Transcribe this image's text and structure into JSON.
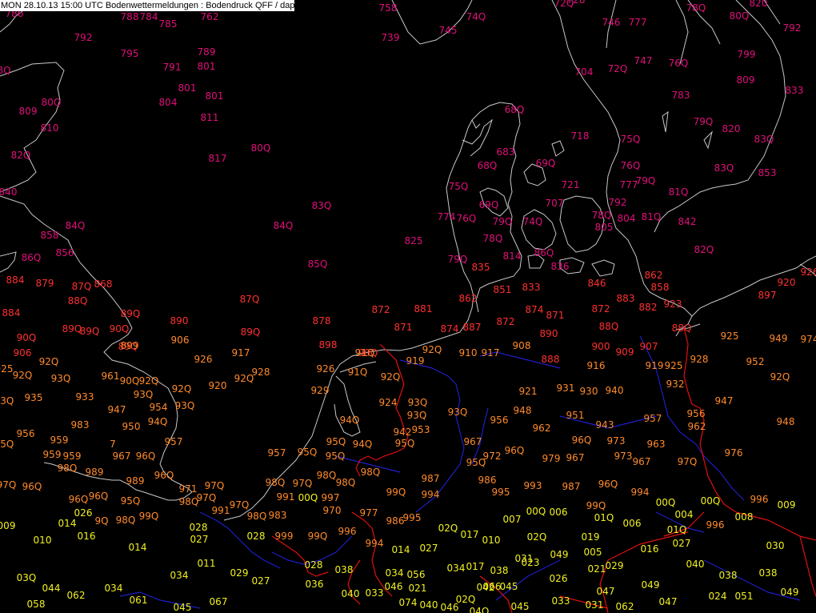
{
  "title": "MON 28.10.13 15:00 UTC  Bodenwettermeldungen :  Bodendruck QFF / dapa",
  "colors": {
    "background": "#000000",
    "coast": "#c8c8c8",
    "river": "#1e1ec8",
    "border": "#e01010",
    "magenta": "#e0107a",
    "red": "#ff3030",
    "orange": "#ff8a2a",
    "yellow": "#f0f020"
  },
  "observations": [
    {
      "t": "786",
      "c": "magenta"
    },
    {
      "t": "792",
      "c": "magenta"
    },
    {
      "t": "788",
      "c": "magenta"
    },
    {
      "t": "784",
      "c": "magenta"
    },
    {
      "t": "785",
      "c": "magenta"
    },
    {
      "t": "762",
      "c": "magenta"
    },
    {
      "t": "758",
      "c": "magenta"
    },
    {
      "t": "739",
      "c": "magenta"
    },
    {
      "t": "74Q",
      "c": "magenta"
    },
    {
      "t": "745",
      "c": "magenta"
    },
    {
      "t": "728",
      "c": "magenta"
    },
    {
      "t": "72Q",
      "c": "magenta"
    },
    {
      "t": "746",
      "c": "magenta"
    },
    {
      "t": "777",
      "c": "magenta"
    },
    {
      "t": "78Q",
      "c": "magenta"
    },
    {
      "t": "80Q",
      "c": "magenta"
    },
    {
      "t": "820",
      "c": "magenta"
    },
    {
      "t": "792",
      "c": "magenta"
    },
    {
      "t": "795",
      "c": "magenta"
    },
    {
      "t": "789",
      "c": "magenta"
    },
    {
      "t": "791",
      "c": "magenta"
    },
    {
      "t": "801",
      "c": "magenta"
    },
    {
      "t": "801",
      "c": "magenta"
    },
    {
      "t": "804",
      "c": "magenta"
    },
    {
      "t": "801",
      "c": "magenta"
    },
    {
      "t": "811",
      "c": "magenta"
    },
    {
      "t": "704",
      "c": "magenta"
    },
    {
      "t": "72Q",
      "c": "magenta"
    },
    {
      "t": "747",
      "c": "magenta"
    },
    {
      "t": "76Q",
      "c": "magenta"
    },
    {
      "t": "799",
      "c": "magenta"
    },
    {
      "t": "809",
      "c": "magenta"
    },
    {
      "t": "833",
      "c": "magenta"
    },
    {
      "t": "783",
      "c": "magenta"
    },
    {
      "t": "8Q",
      "c": "magenta"
    },
    {
      "t": "809",
      "c": "magenta"
    },
    {
      "t": "80Q",
      "c": "magenta"
    },
    {
      "t": "810",
      "c": "magenta"
    },
    {
      "t": "68Q",
      "c": "magenta"
    },
    {
      "t": "718",
      "c": "magenta"
    },
    {
      "t": "75Q",
      "c": "magenta"
    },
    {
      "t": "79Q",
      "c": "magenta"
    },
    {
      "t": "820",
      "c": "magenta"
    },
    {
      "t": "83Q",
      "c": "magenta"
    },
    {
      "t": "683",
      "c": "magenta"
    },
    {
      "t": "68Q",
      "c": "magenta"
    },
    {
      "t": "69Q",
      "c": "magenta"
    },
    {
      "t": "76Q",
      "c": "magenta"
    },
    {
      "t": "83Q",
      "c": "magenta"
    },
    {
      "t": "853",
      "c": "magenta"
    },
    {
      "t": "82Q",
      "c": "magenta"
    },
    {
      "t": "817",
      "c": "magenta"
    },
    {
      "t": "80Q",
      "c": "magenta"
    },
    {
      "t": "75Q",
      "c": "magenta"
    },
    {
      "t": "721",
      "c": "magenta"
    },
    {
      "t": "777",
      "c": "magenta"
    },
    {
      "t": "79Q",
      "c": "magenta"
    },
    {
      "t": "81Q",
      "c": "magenta"
    },
    {
      "t": "840",
      "c": "magenta"
    },
    {
      "t": "83Q",
      "c": "magenta"
    },
    {
      "t": "69Q",
      "c": "magenta"
    },
    {
      "t": "707",
      "c": "magenta"
    },
    {
      "t": "792",
      "c": "magenta"
    },
    {
      "t": "774",
      "c": "magenta"
    },
    {
      "t": "76Q",
      "c": "magenta"
    },
    {
      "t": "79Q",
      "c": "magenta"
    },
    {
      "t": "74Q",
      "c": "magenta"
    },
    {
      "t": "78Q",
      "c": "magenta"
    },
    {
      "t": "804",
      "c": "magenta"
    },
    {
      "t": "81Q",
      "c": "magenta"
    },
    {
      "t": "842",
      "c": "magenta"
    },
    {
      "t": "84Q",
      "c": "magenta"
    },
    {
      "t": "84Q",
      "c": "magenta"
    },
    {
      "t": "805",
      "c": "magenta"
    },
    {
      "t": "858",
      "c": "magenta"
    },
    {
      "t": "78Q",
      "c": "magenta"
    },
    {
      "t": "825",
      "c": "magenta"
    },
    {
      "t": "856",
      "c": "magenta"
    },
    {
      "t": "86Q",
      "c": "magenta"
    },
    {
      "t": "82Q",
      "c": "magenta"
    },
    {
      "t": "79Q",
      "c": "magenta"
    },
    {
      "t": "814",
      "c": "magenta"
    },
    {
      "t": "86Q",
      "c": "magenta"
    },
    {
      "t": "85Q",
      "c": "magenta"
    },
    {
      "t": "835",
      "c": "red"
    },
    {
      "t": "836",
      "c": "magenta"
    },
    {
      "t": "862",
      "c": "red"
    },
    {
      "t": "884",
      "c": "red"
    },
    {
      "t": "879",
      "c": "red"
    },
    {
      "t": "87Q",
      "c": "red"
    },
    {
      "t": "868",
      "c": "red"
    },
    {
      "t": "851",
      "c": "red"
    },
    {
      "t": "833",
      "c": "red"
    },
    {
      "t": "846",
      "c": "red"
    },
    {
      "t": "858",
      "c": "red"
    },
    {
      "t": "920",
      "c": "red"
    },
    {
      "t": "926",
      "c": "red"
    },
    {
      "t": "88Q",
      "c": "red"
    },
    {
      "t": "87Q",
      "c": "red"
    },
    {
      "t": "862",
      "c": "red"
    },
    {
      "t": "872",
      "c": "red"
    },
    {
      "t": "881",
      "c": "red"
    },
    {
      "t": "874",
      "c": "red"
    },
    {
      "t": "871",
      "c": "red"
    },
    {
      "t": "872",
      "c": "red"
    },
    {
      "t": "883",
      "c": "red"
    },
    {
      "t": "882",
      "c": "red"
    },
    {
      "t": "923",
      "c": "red"
    },
    {
      "t": "897",
      "c": "red"
    },
    {
      "t": "884",
      "c": "red"
    },
    {
      "t": "89Q",
      "c": "red"
    },
    {
      "t": "890",
      "c": "red"
    },
    {
      "t": "878",
      "c": "red"
    },
    {
      "t": "871",
      "c": "red"
    },
    {
      "t": "874",
      "c": "red"
    },
    {
      "t": "887",
      "c": "red"
    },
    {
      "t": "872",
      "c": "red"
    },
    {
      "t": "890",
      "c": "red"
    },
    {
      "t": "88Q",
      "c": "red"
    },
    {
      "t": "88Q",
      "c": "red"
    },
    {
      "t": "90Q",
      "c": "red"
    },
    {
      "t": "89Q",
      "c": "red"
    },
    {
      "t": "89Q",
      "c": "red"
    },
    {
      "t": "90Q",
      "c": "red"
    },
    {
      "t": "89Q",
      "c": "red"
    },
    {
      "t": "89Q",
      "c": "red"
    },
    {
      "t": "906",
      "c": "red"
    },
    {
      "t": "898",
      "c": "red"
    },
    {
      "t": "90Q",
      "c": "red"
    },
    {
      "t": "888",
      "c": "red"
    },
    {
      "t": "900",
      "c": "red"
    },
    {
      "t": "909",
      "c": "red"
    },
    {
      "t": "907",
      "c": "red"
    },
    {
      "t": "925",
      "c": "orange"
    },
    {
      "t": "949",
      "c": "orange"
    },
    {
      "t": "974",
      "c": "orange"
    },
    {
      "t": "906",
      "c": "orange"
    },
    {
      "t": "899",
      "c": "orange"
    },
    {
      "t": "917",
      "c": "orange"
    },
    {
      "t": "91Q",
      "c": "orange"
    },
    {
      "t": "92Q",
      "c": "orange"
    },
    {
      "t": "919",
      "c": "orange"
    },
    {
      "t": "910",
      "c": "orange"
    },
    {
      "t": "917",
      "c": "orange"
    },
    {
      "t": "908",
      "c": "orange"
    },
    {
      "t": "916",
      "c": "orange"
    },
    {
      "t": "919",
      "c": "orange"
    },
    {
      "t": "925",
      "c": "orange"
    },
    {
      "t": "928",
      "c": "orange"
    },
    {
      "t": "952",
      "c": "orange"
    },
    {
      "t": "925",
      "c": "orange"
    },
    {
      "t": "92Q",
      "c": "orange"
    },
    {
      "t": "92Q",
      "c": "orange"
    },
    {
      "t": "926",
      "c": "orange"
    },
    {
      "t": "92Q",
      "c": "orange"
    },
    {
      "t": "928",
      "c": "orange"
    },
    {
      "t": "926",
      "c": "orange"
    },
    {
      "t": "91Q",
      "c": "orange"
    },
    {
      "t": "92Q",
      "c": "orange"
    },
    {
      "t": "92Q",
      "c": "orange"
    },
    {
      "t": "93Q",
      "c": "orange"
    },
    {
      "t": "93Q",
      "c": "orange"
    },
    {
      "t": "961",
      "c": "orange"
    },
    {
      "t": "90Q",
      "c": "orange"
    },
    {
      "t": "92Q",
      "c": "orange"
    },
    {
      "t": "920",
      "c": "orange"
    },
    {
      "t": "921",
      "c": "orange"
    },
    {
      "t": "931",
      "c": "orange"
    },
    {
      "t": "930",
      "c": "orange"
    },
    {
      "t": "940",
      "c": "orange"
    },
    {
      "t": "932",
      "c": "orange"
    },
    {
      "t": "935",
      "c": "orange"
    },
    {
      "t": "933",
      "c": "orange"
    },
    {
      "t": "93Q",
      "c": "orange"
    },
    {
      "t": "92Q",
      "c": "orange"
    },
    {
      "t": "929",
      "c": "orange"
    },
    {
      "t": "924",
      "c": "orange"
    },
    {
      "t": "93Q",
      "c": "orange"
    },
    {
      "t": "947",
      "c": "orange"
    },
    {
      "t": "947",
      "c": "orange"
    },
    {
      "t": "954",
      "c": "orange"
    },
    {
      "t": "93Q",
      "c": "orange"
    },
    {
      "t": "93Q",
      "c": "orange"
    },
    {
      "t": "93Q",
      "c": "orange"
    },
    {
      "t": "956",
      "c": "orange"
    },
    {
      "t": "948",
      "c": "orange"
    },
    {
      "t": "951",
      "c": "orange"
    },
    {
      "t": "943",
      "c": "orange"
    },
    {
      "t": "957",
      "c": "orange"
    },
    {
      "t": "956",
      "c": "orange"
    },
    {
      "t": "948",
      "c": "orange"
    },
    {
      "t": "956",
      "c": "orange"
    },
    {
      "t": "983",
      "c": "orange"
    },
    {
      "t": "950",
      "c": "orange"
    },
    {
      "t": "94Q",
      "c": "orange"
    },
    {
      "t": "94Q",
      "c": "orange"
    },
    {
      "t": "942",
      "c": "orange"
    },
    {
      "t": "953",
      "c": "orange"
    },
    {
      "t": "962",
      "c": "orange"
    },
    {
      "t": "962",
      "c": "orange"
    },
    {
      "t": "95Q",
      "c": "orange"
    },
    {
      "t": "959",
      "c": "orange"
    },
    {
      "t": "7",
      "c": "orange"
    },
    {
      "t": "957",
      "c": "orange"
    },
    {
      "t": "95Q",
      "c": "orange"
    },
    {
      "t": "94Q",
      "c": "orange"
    },
    {
      "t": "95Q",
      "c": "orange"
    },
    {
      "t": "967",
      "c": "orange"
    },
    {
      "t": "96Q",
      "c": "orange"
    },
    {
      "t": "973",
      "c": "orange"
    },
    {
      "t": "963",
      "c": "orange"
    },
    {
      "t": "959",
      "c": "orange"
    },
    {
      "t": "959",
      "c": "orange"
    },
    {
      "t": "967",
      "c": "orange"
    },
    {
      "t": "96Q",
      "c": "orange"
    },
    {
      "t": "957",
      "c": "orange"
    },
    {
      "t": "95Q",
      "c": "orange"
    },
    {
      "t": "95Q",
      "c": "orange"
    },
    {
      "t": "95Q",
      "c": "orange"
    },
    {
      "t": "96Q",
      "c": "orange"
    },
    {
      "t": "972",
      "c": "orange"
    },
    {
      "t": "979",
      "c": "orange"
    },
    {
      "t": "967",
      "c": "orange"
    },
    {
      "t": "973",
      "c": "orange"
    },
    {
      "t": "967",
      "c": "orange"
    },
    {
      "t": "97Q",
      "c": "orange"
    },
    {
      "t": "976",
      "c": "orange"
    },
    {
      "t": "98Q",
      "c": "orange"
    },
    {
      "t": "989",
      "c": "orange"
    },
    {
      "t": "989",
      "c": "orange"
    },
    {
      "t": "96Q",
      "c": "orange"
    },
    {
      "t": "96Q",
      "c": "orange"
    },
    {
      "t": "96Q",
      "c": "orange"
    },
    {
      "t": "95Q",
      "c": "orange"
    },
    {
      "t": "97Q",
      "c": "orange"
    },
    {
      "t": "98Q",
      "c": "orange"
    },
    {
      "t": "97Q",
      "c": "orange"
    },
    {
      "t": "98Q",
      "c": "orange"
    },
    {
      "t": "98Q",
      "c": "orange"
    },
    {
      "t": "98Q",
      "c": "orange"
    },
    {
      "t": "987",
      "c": "orange"
    },
    {
      "t": "986",
      "c": "orange"
    },
    {
      "t": "993",
      "c": "orange"
    },
    {
      "t": "987",
      "c": "orange"
    },
    {
      "t": "96Q",
      "c": "orange"
    },
    {
      "t": "97Q",
      "c": "orange"
    },
    {
      "t": "96Q",
      "c": "orange"
    },
    {
      "t": "971",
      "c": "orange"
    },
    {
      "t": "991",
      "c": "orange"
    },
    {
      "t": "00Q",
      "c": "yellow"
    },
    {
      "t": "997",
      "c": "orange"
    },
    {
      "t": "99Q",
      "c": "orange"
    },
    {
      "t": "994",
      "c": "orange"
    },
    {
      "t": "995",
      "c": "orange"
    },
    {
      "t": "994",
      "c": "orange"
    },
    {
      "t": "98Q",
      "c": "orange"
    },
    {
      "t": "97Q",
      "c": "orange"
    },
    {
      "t": "97Q",
      "c": "orange"
    },
    {
      "t": "970",
      "c": "orange"
    },
    {
      "t": "977",
      "c": "orange"
    },
    {
      "t": "99Q",
      "c": "orange"
    },
    {
      "t": "00Q",
      "c": "yellow"
    },
    {
      "t": "00Q",
      "c": "yellow"
    },
    {
      "t": "996",
      "c": "orange"
    },
    {
      "t": "009",
      "c": "yellow"
    },
    {
      "t": "009",
      "c": "yellow"
    },
    {
      "t": "014",
      "c": "yellow"
    },
    {
      "t": "026",
      "c": "yellow"
    },
    {
      "t": "9Q",
      "c": "orange"
    },
    {
      "t": "98Q",
      "c": "orange"
    },
    {
      "t": "99Q",
      "c": "orange"
    },
    {
      "t": "991",
      "c": "orange"
    },
    {
      "t": "98Q",
      "c": "orange"
    },
    {
      "t": "983",
      "c": "orange"
    },
    {
      "t": "986",
      "c": "orange"
    },
    {
      "t": "995",
      "c": "orange"
    },
    {
      "t": "007",
      "c": "yellow"
    },
    {
      "t": "00Q",
      "c": "yellow"
    },
    {
      "t": "006",
      "c": "yellow"
    },
    {
      "t": "01Q",
      "c": "yellow"
    },
    {
      "t": "006",
      "c": "yellow"
    },
    {
      "t": "004",
      "c": "yellow"
    },
    {
      "t": "996",
      "c": "orange"
    },
    {
      "t": "008",
      "c": "yellow"
    },
    {
      "t": "010",
      "c": "yellow"
    },
    {
      "t": "016",
      "c": "yellow"
    },
    {
      "t": "028",
      "c": "yellow"
    },
    {
      "t": "028",
      "c": "yellow"
    },
    {
      "t": "999",
      "c": "orange"
    },
    {
      "t": "99Q",
      "c": "orange"
    },
    {
      "t": "996",
      "c": "orange"
    },
    {
      "t": "994",
      "c": "orange"
    },
    {
      "t": "014",
      "c": "yellow"
    },
    {
      "t": "02Q",
      "c": "yellow"
    },
    {
      "t": "017",
      "c": "yellow"
    },
    {
      "t": "010",
      "c": "yellow"
    },
    {
      "t": "02Q",
      "c": "yellow"
    },
    {
      "t": "019",
      "c": "yellow"
    },
    {
      "t": "01Q",
      "c": "yellow"
    },
    {
      "t": "016",
      "c": "yellow"
    },
    {
      "t": "027",
      "c": "yellow"
    },
    {
      "t": "030",
      "c": "yellow"
    },
    {
      "t": "014",
      "c": "yellow"
    },
    {
      "t": "027",
      "c": "yellow"
    },
    {
      "t": "027",
      "c": "yellow"
    },
    {
      "t": "031",
      "c": "yellow"
    },
    {
      "t": "049",
      "c": "yellow"
    },
    {
      "t": "005",
      "c": "yellow"
    },
    {
      "t": "011",
      "c": "yellow"
    },
    {
      "t": "028",
      "c": "yellow"
    },
    {
      "t": "038",
      "c": "yellow"
    },
    {
      "t": "034",
      "c": "yellow"
    },
    {
      "t": "017",
      "c": "yellow"
    },
    {
      "t": "038",
      "c": "yellow"
    },
    {
      "t": "023",
      "c": "yellow"
    },
    {
      "t": "021",
      "c": "yellow"
    },
    {
      "t": "029",
      "c": "yellow"
    },
    {
      "t": "040",
      "c": "yellow"
    },
    {
      "t": "038",
      "c": "yellow"
    },
    {
      "t": "038",
      "c": "yellow"
    },
    {
      "t": "034",
      "c": "yellow"
    },
    {
      "t": "029",
      "c": "yellow"
    },
    {
      "t": "034",
      "c": "yellow"
    },
    {
      "t": "056",
      "c": "yellow"
    },
    {
      "t": "066",
      "c": "yellow"
    },
    {
      "t": "026",
      "c": "yellow"
    },
    {
      "t": "03Q",
      "c": "yellow"
    },
    {
      "t": "027",
      "c": "yellow"
    },
    {
      "t": "036",
      "c": "yellow"
    },
    {
      "t": "046",
      "c": "yellow"
    },
    {
      "t": "021",
      "c": "yellow"
    },
    {
      "t": "042",
      "c": "yellow"
    },
    {
      "t": "045",
      "c": "yellow"
    },
    {
      "t": "047",
      "c": "yellow"
    },
    {
      "t": "049",
      "c": "yellow"
    },
    {
      "t": "044",
      "c": "yellow"
    },
    {
      "t": "034",
      "c": "yellow"
    },
    {
      "t": "040",
      "c": "yellow"
    },
    {
      "t": "033",
      "c": "yellow"
    },
    {
      "t": "02Q",
      "c": "yellow"
    },
    {
      "t": "024",
      "c": "yellow"
    },
    {
      "t": "051",
      "c": "yellow"
    },
    {
      "t": "049",
      "c": "yellow"
    },
    {
      "t": "062",
      "c": "yellow"
    },
    {
      "t": "061",
      "c": "yellow"
    },
    {
      "t": "067",
      "c": "yellow"
    },
    {
      "t": "074",
      "c": "yellow"
    },
    {
      "t": "033",
      "c": "yellow"
    },
    {
      "t": "031",
      "c": "yellow"
    },
    {
      "t": "047",
      "c": "yellow"
    },
    {
      "t": "058",
      "c": "yellow"
    },
    {
      "t": "045",
      "c": "yellow"
    },
    {
      "t": "040",
      "c": "yellow"
    },
    {
      "t": "046",
      "c": "yellow"
    },
    {
      "t": "04Q",
      "c": "yellow"
    },
    {
      "t": "045",
      "c": "yellow"
    },
    {
      "t": "062",
      "c": "yellow"
    },
    {
      "t": "043",
      "c": "yellow"
    },
    {
      "t": "061",
      "c": "yellow"
    },
    {
      "t": "048",
      "c": "yellow"
    },
    {
      "t": "043",
      "c": "yellow"
    }
  ]
}
